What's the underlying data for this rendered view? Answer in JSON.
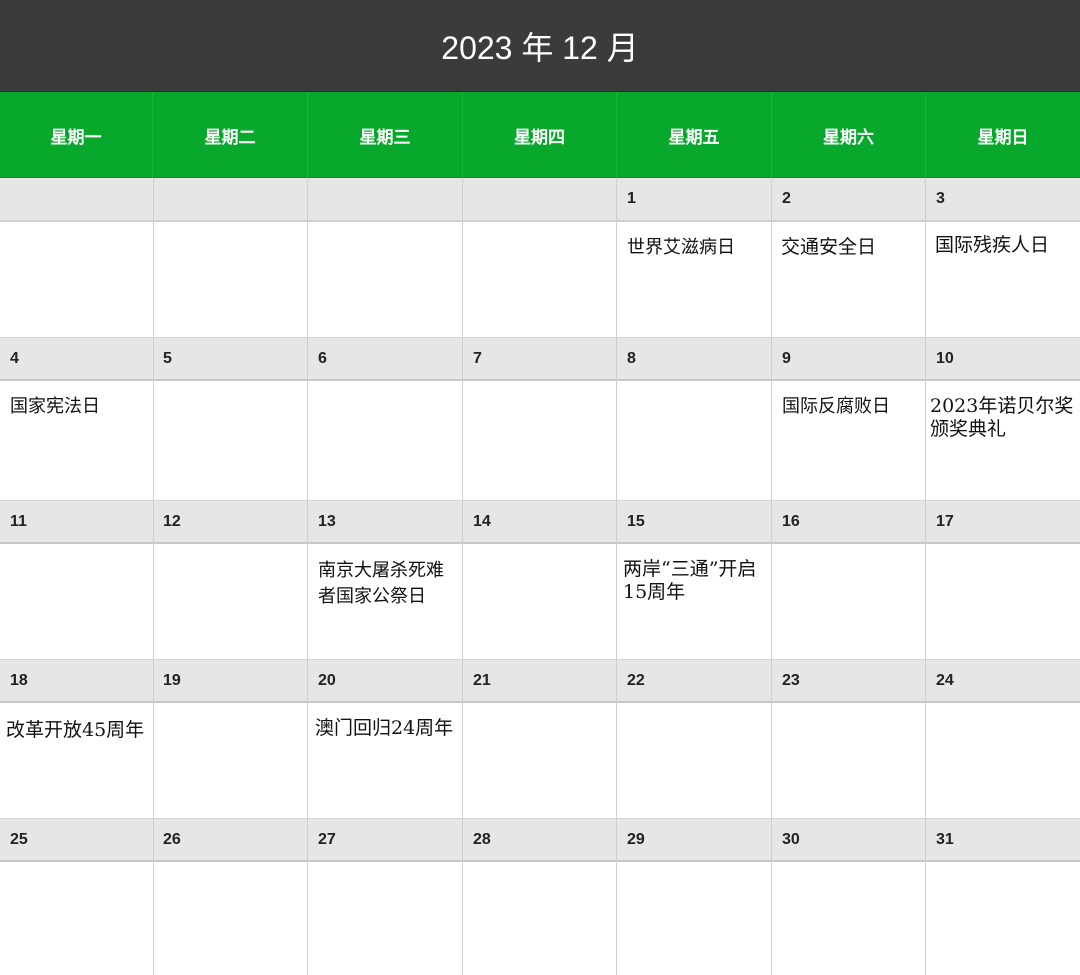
{
  "header": {
    "title": "2023 年 12 月"
  },
  "weekdays": [
    "星期一",
    "星期二",
    "星期三",
    "星期四",
    "星期五",
    "星期六",
    "星期日"
  ],
  "weeks": [
    {
      "dates": [
        "",
        "",
        "",
        "",
        "1",
        "2",
        "3"
      ],
      "events": [
        "",
        "",
        "",
        "",
        "世界艾滋病日",
        "交通安全日",
        "国际残疾人日"
      ]
    },
    {
      "dates": [
        "4",
        "5",
        "6",
        "7",
        "8",
        "9",
        "10"
      ],
      "events": [
        "国家宪法日",
        "",
        "",
        "",
        "",
        "国际反腐败日",
        "2023年诺贝尔奖颁奖典礼"
      ]
    },
    {
      "dates": [
        "11",
        "12",
        "13",
        "14",
        "15",
        "16",
        "17"
      ],
      "events": [
        "",
        "",
        "南京大屠杀死难者国家公祭日",
        "",
        "两岸“三通”开启15周年",
        "",
        ""
      ]
    },
    {
      "dates": [
        "18",
        "19",
        "20",
        "21",
        "22",
        "23",
        "24"
      ],
      "events": [
        "改革开放45周年",
        "",
        "澳门回归24周年",
        "",
        "",
        "",
        ""
      ]
    },
    {
      "dates": [
        "25",
        "26",
        "27",
        "28",
        "29",
        "30",
        "31"
      ],
      "events": [
        "",
        "",
        "",
        "",
        "",
        "",
        ""
      ]
    }
  ]
}
